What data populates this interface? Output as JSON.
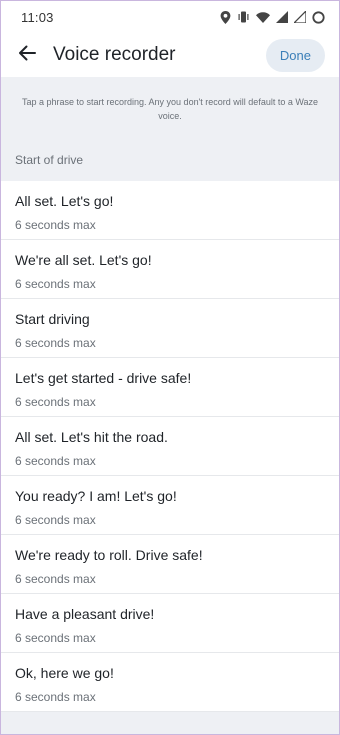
{
  "status_bar": {
    "time": "11:03",
    "icons": [
      "location-icon",
      "vibrate-icon",
      "wifi-icon",
      "signal-icon",
      "signal-icon",
      "battery-ring-icon"
    ]
  },
  "app_bar": {
    "title": "Voice recorder",
    "done_label": "Done",
    "back_icon": "arrow-left-icon"
  },
  "info_text": "Tap a phrase to start recording. Any you don't record will default to a Waze voice.",
  "section": {
    "header": "Start of drive",
    "items": [
      {
        "title": "All set. Let's go!",
        "subtitle": "6 seconds max"
      },
      {
        "title": "We're all set. Let's go!",
        "subtitle": "6 seconds max"
      },
      {
        "title": "Start driving",
        "subtitle": "6 seconds max"
      },
      {
        "title": "Let's get started - drive safe!",
        "subtitle": "6 seconds max"
      },
      {
        "title": "All set. Let's hit the road.",
        "subtitle": "6 seconds max"
      },
      {
        "title": "You ready? I am! Let's go!",
        "subtitle": "6 seconds max"
      },
      {
        "title": "We're ready to roll. Drive safe!",
        "subtitle": "6 seconds max"
      },
      {
        "title": "Have a pleasant drive!",
        "subtitle": "6 seconds max"
      },
      {
        "title": "Ok, here we go!",
        "subtitle": "6 seconds max"
      }
    ]
  },
  "colors": {
    "accent": "#3b7fb8",
    "done_bg": "#e6ecf3",
    "background": "#eef0f4"
  }
}
